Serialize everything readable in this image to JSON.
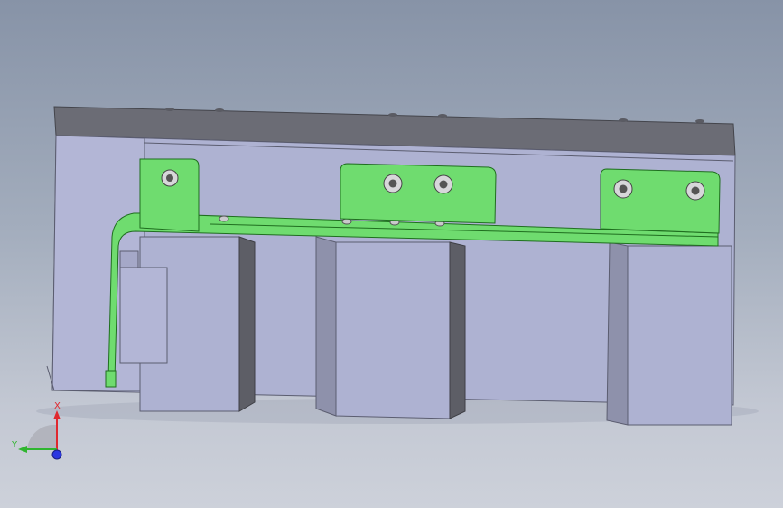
{
  "view": {
    "background_top": "#8793a7",
    "background_bottom": "#cdd1da",
    "part_color": "#aeb2d2",
    "part_dark": "#6b6c75",
    "bracket_color": "#6fdc6f",
    "bracket_edge": "#1f6e1f"
  },
  "triad": {
    "x_label": "X",
    "y_label": "Y",
    "x_color": "#e0282e",
    "y_color": "#2fb52f",
    "z_color": "#2a36e0"
  }
}
